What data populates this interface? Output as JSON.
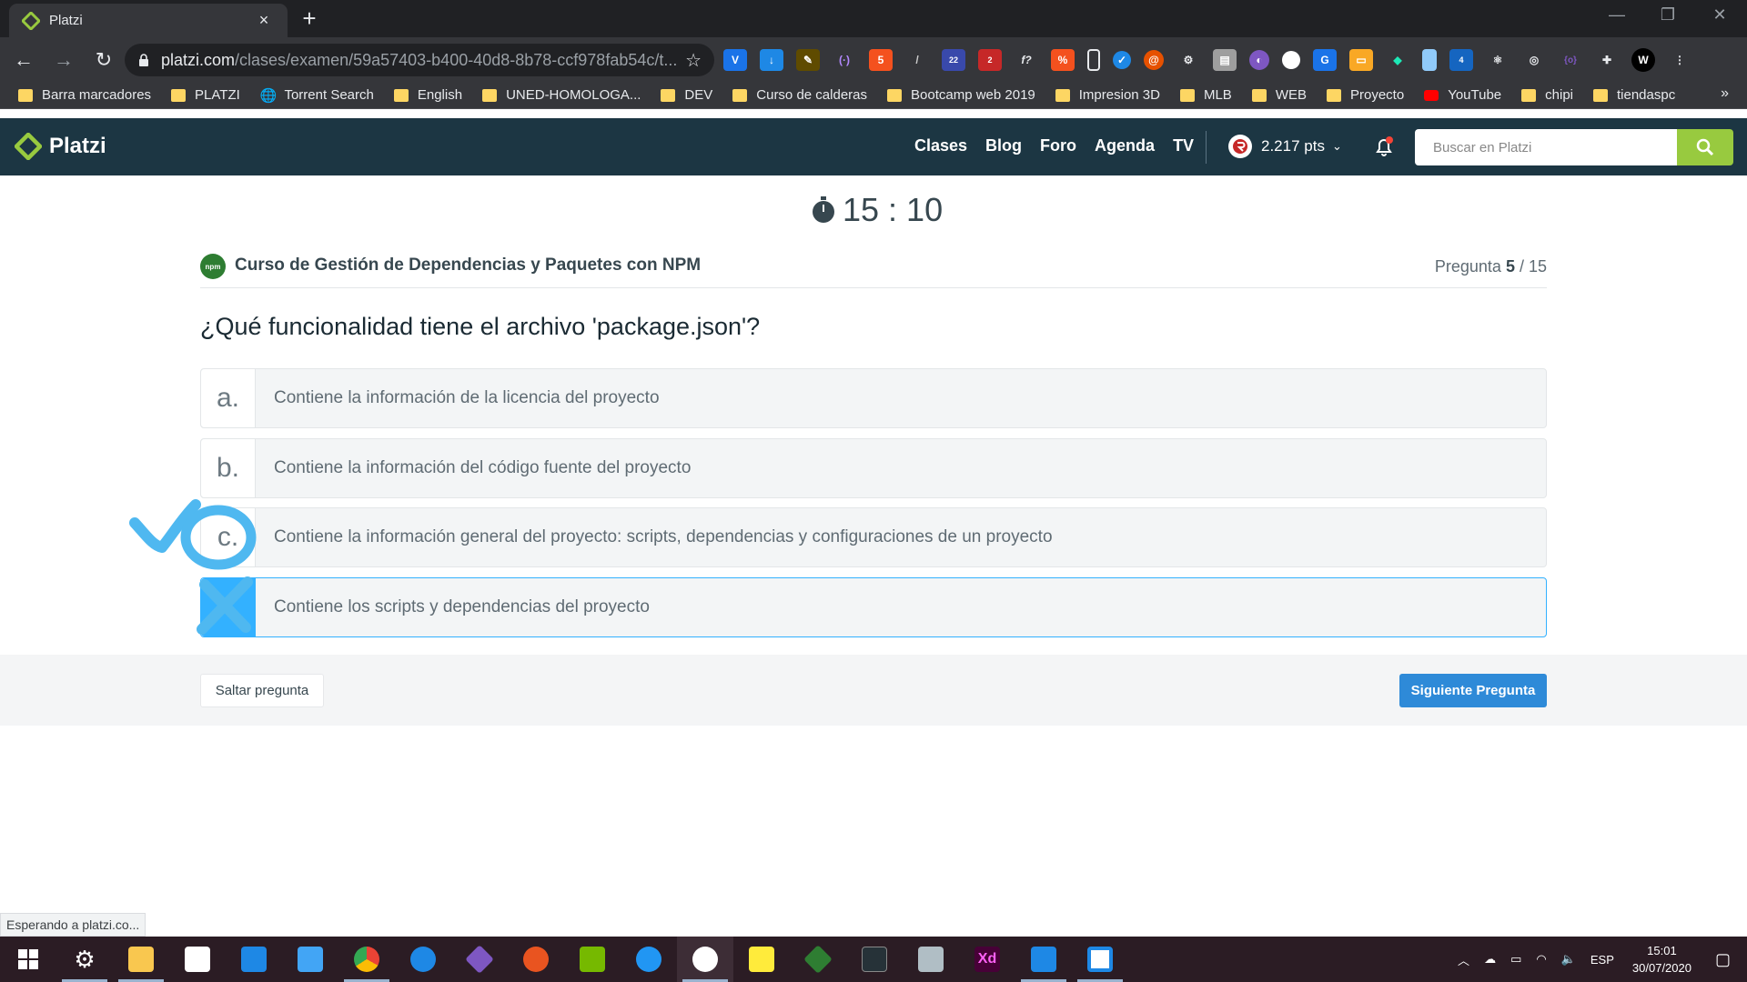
{
  "browser": {
    "tab_title": "Platzi",
    "url_host": "platzi.com",
    "url_rest": "/clases/examen/59a57403-b400-40d8-8b78-ccf978fab54c/t...",
    "bookmarks": [
      "Barra marcadores",
      "PLATZI",
      "Torrent Search",
      "English",
      "UNED-HOMOLOGA...",
      "DEV",
      "Curso de calderas",
      "Bootcamp web 2019",
      "Impresion 3D",
      "MLB",
      "WEB",
      "Proyecto",
      "YouTube",
      "chipi",
      "tiendaspc"
    ],
    "ext_badges": [
      "22",
      "2",
      "4"
    ],
    "status_text": "Esperando a platzi.co..."
  },
  "header": {
    "logo_text": "Platzi",
    "nav": [
      "Clases",
      "Blog",
      "Foro",
      "Agenda",
      "TV"
    ],
    "points": "2.217 pts",
    "search_placeholder": "Buscar en Platzi"
  },
  "exam": {
    "timer": "15 : 10",
    "course_title": "Curso de Gestión de Dependencias y Paquetes con NPM",
    "npm_badge": "npm",
    "question_label": "Pregunta",
    "question_current": "5",
    "question_total": "/ 15",
    "question": "¿Qué funcionalidad tiene el archivo 'package.json'?",
    "options": [
      {
        "letter": "a.",
        "text": "Contiene la información de la licencia del proyecto"
      },
      {
        "letter": "b.",
        "text": "Contiene la información del código fuente del proyecto"
      },
      {
        "letter": "c.",
        "text": "Contiene la información general del proyecto: scripts, dependencias y configuraciones de un proyecto"
      },
      {
        "letter": "d.",
        "text": "Contiene los scripts y dependencias del proyecto"
      }
    ],
    "selected_option": "d.",
    "skip_label": "Saltar pregunta",
    "next_label": "Siguiente Pregunta"
  },
  "taskbar": {
    "lang": "ESP",
    "time": "15:01",
    "date": "30/07/2020"
  },
  "colors": {
    "platzi_header": "#1c3643",
    "platzi_green": "#98ca3f",
    "selected_blue": "#33b1ff",
    "next_button": "#2e8ad8",
    "annotation": "#4fb8f0"
  }
}
